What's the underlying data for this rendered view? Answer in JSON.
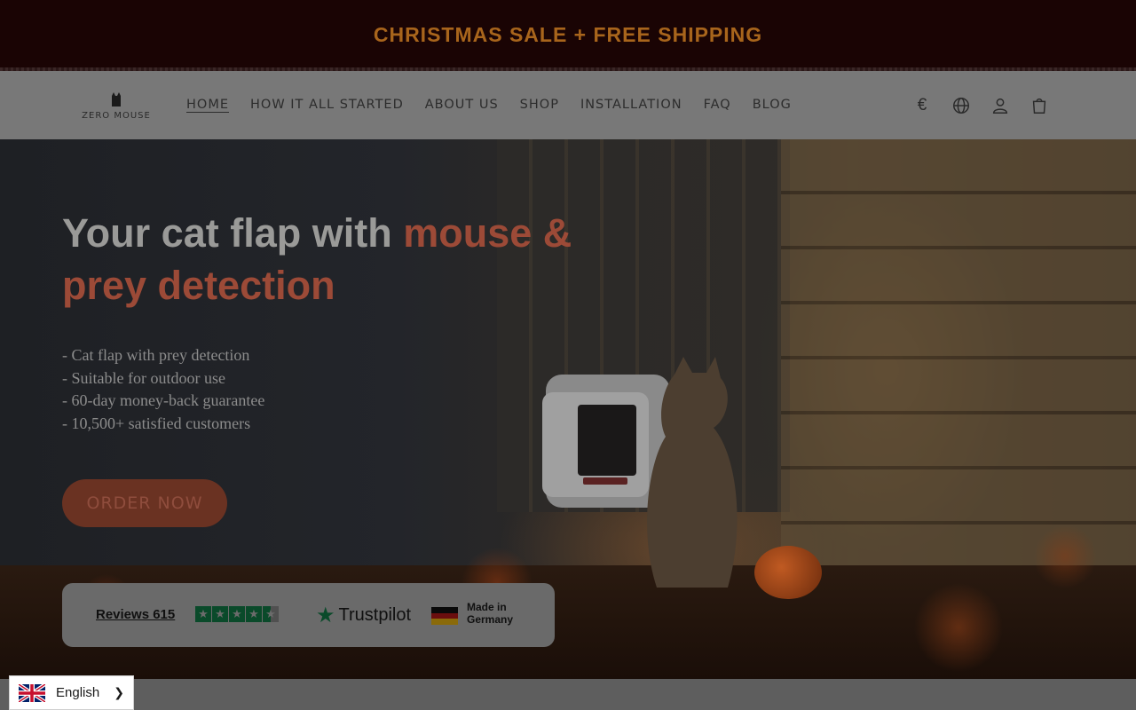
{
  "announcement": {
    "text": "CHRISTMAS SALE + FREE SHIPPING"
  },
  "header": {
    "logo_text": "ZERO MOUSE",
    "nav": [
      {
        "label": "HOME",
        "active": true
      },
      {
        "label": "HOW IT ALL STARTED"
      },
      {
        "label": "ABOUT US"
      },
      {
        "label": "SHOP"
      },
      {
        "label": "INSTALLATION"
      },
      {
        "label": "FAQ"
      },
      {
        "label": "BLOG"
      }
    ],
    "currency_symbol": "€",
    "icons": [
      "currency-icon",
      "globe-icon",
      "account-icon",
      "cart-icon"
    ]
  },
  "hero": {
    "title_plain": "Your cat flap with ",
    "title_accent_1": "mouse &",
    "title_accent_2": "prey detection",
    "bullets": [
      "- Cat flap with prey detection",
      "- Suitable for outdoor use",
      "- 60-day money-back guarantee",
      "- 10,500+ satisfied customers"
    ],
    "cta_label": "ORDER NOW"
  },
  "trust_bar": {
    "reviews_label": "Reviews 615",
    "rating_stars": 4.5,
    "trustpilot_label": "Trustpilot",
    "made_in_line1": "Made in",
    "made_in_line2": "Germany"
  },
  "language_selector": {
    "label": "English"
  },
  "colors": {
    "announcement_bg": "#1a0404",
    "announcement_text": "#a8651c",
    "accent": "#9c4a37",
    "trustpilot_green": "#0a4a2a"
  }
}
